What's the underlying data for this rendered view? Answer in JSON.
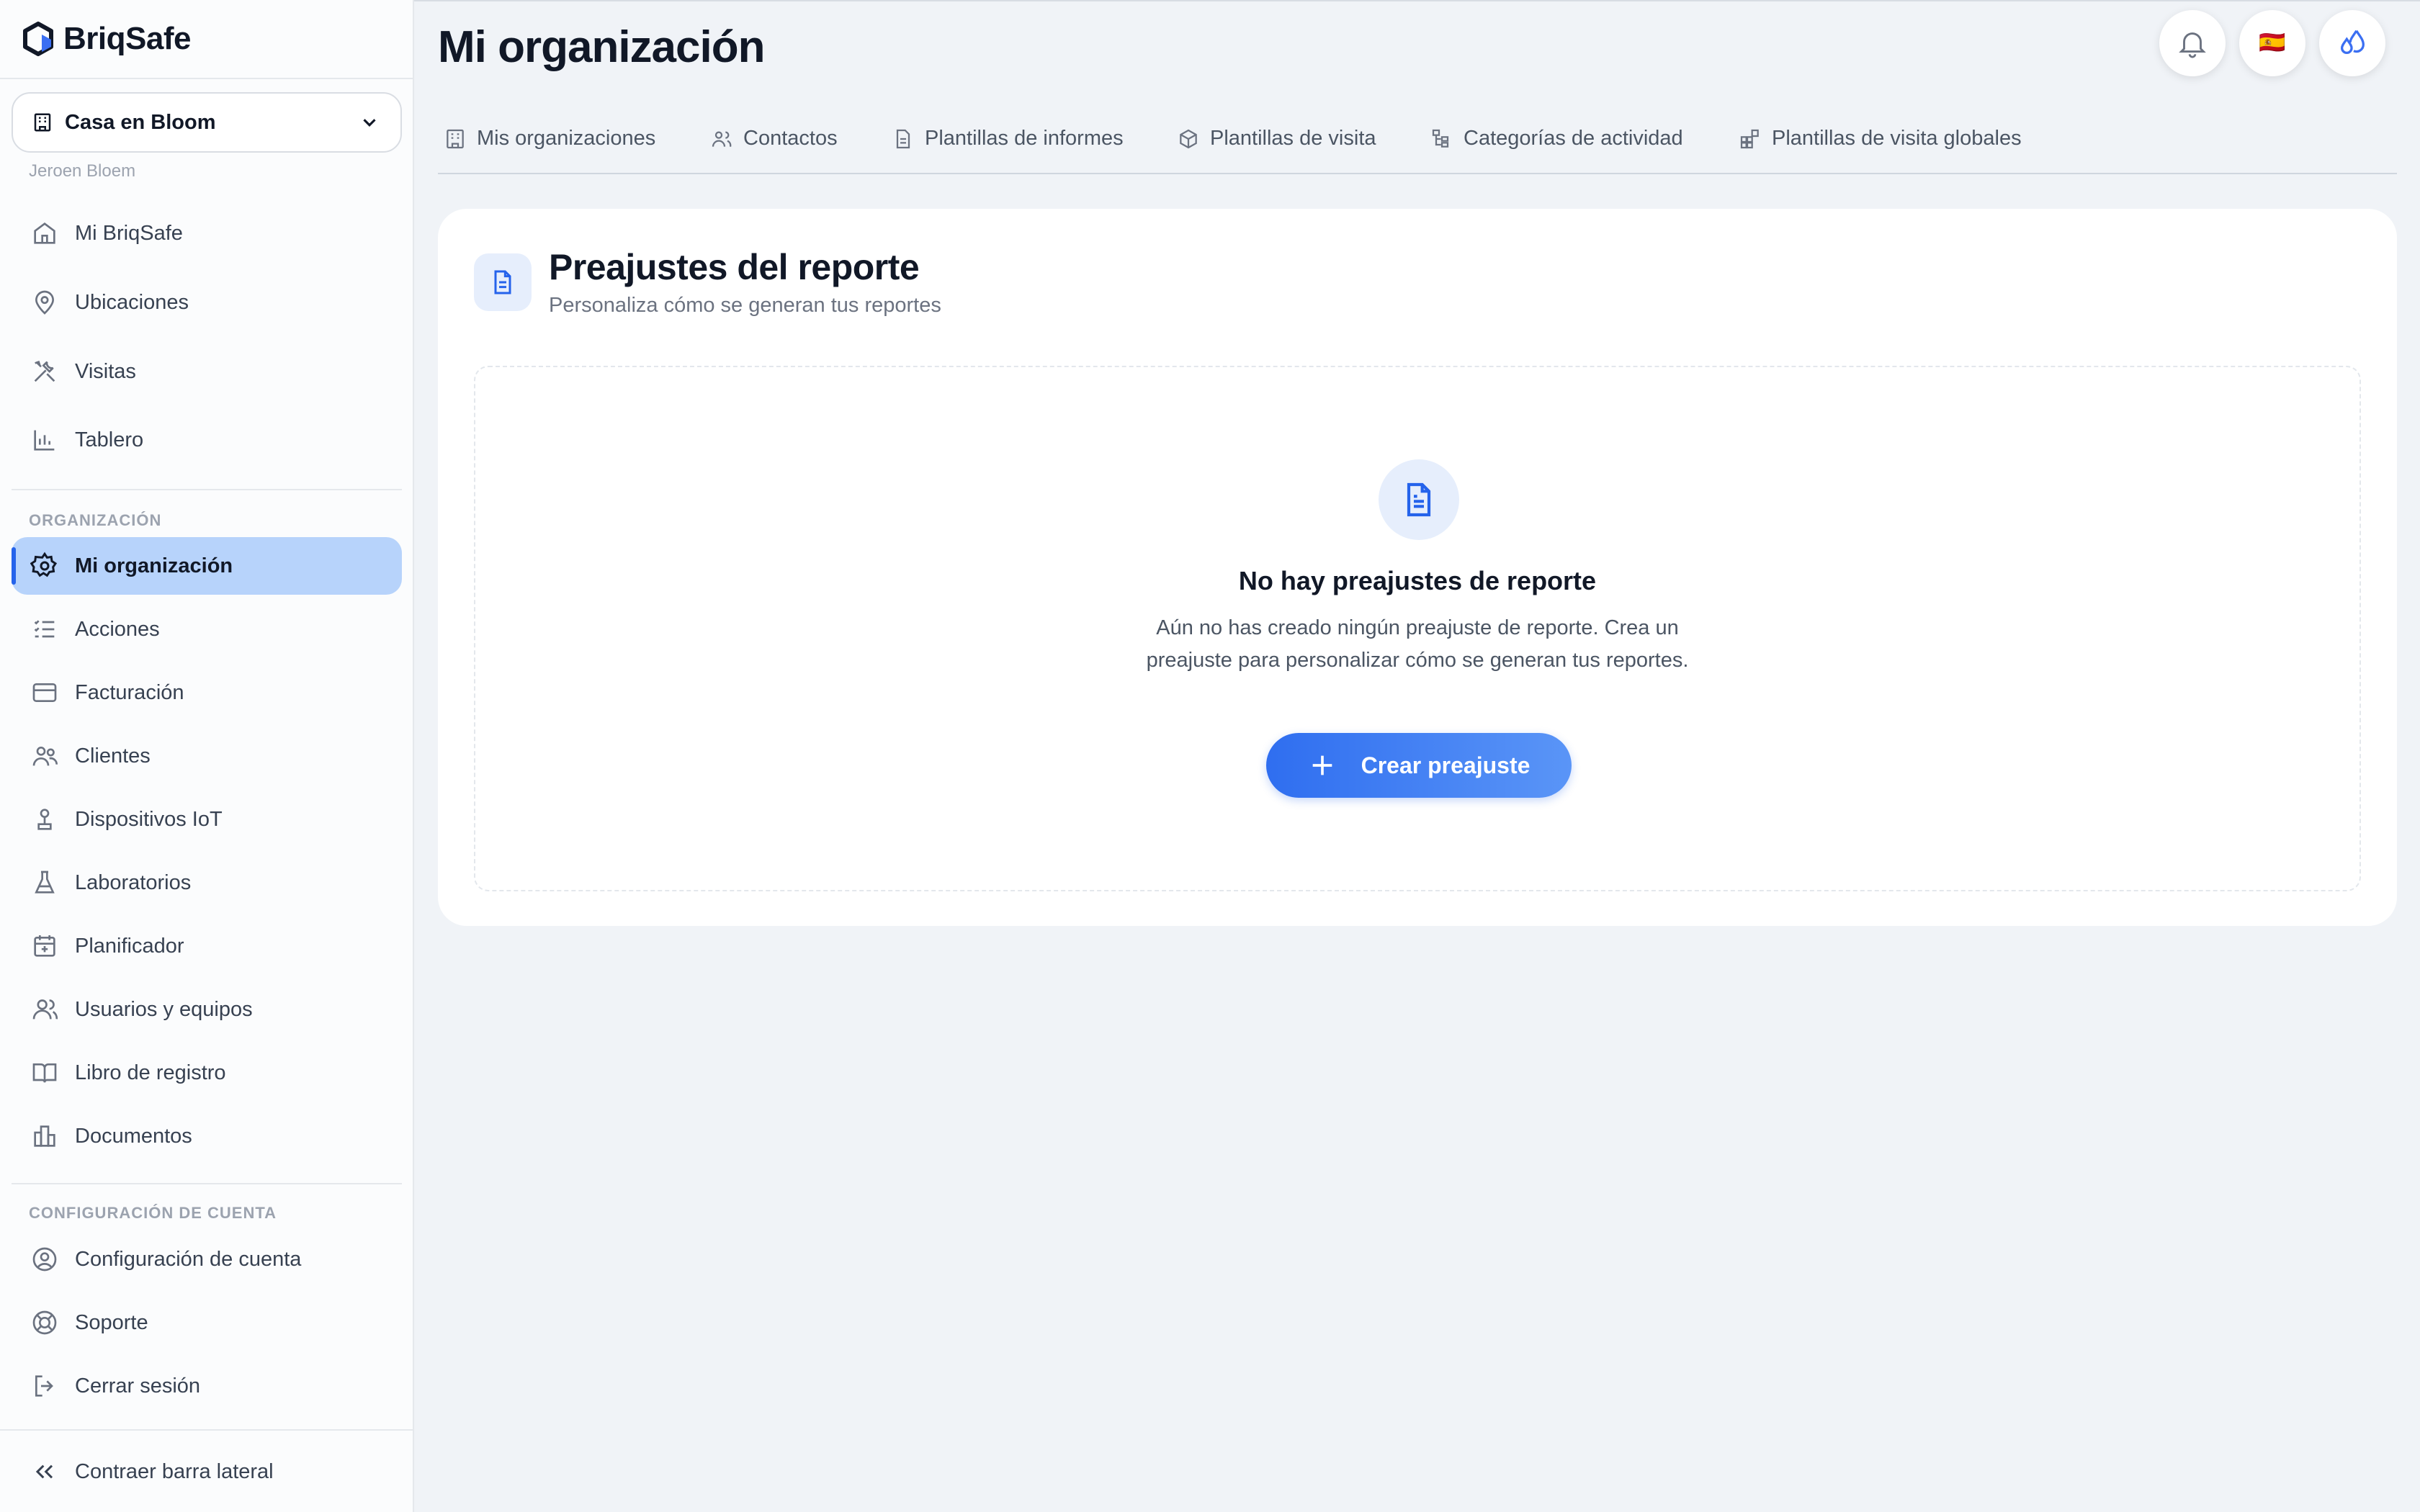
{
  "app": {
    "brand": "BriqSafe",
    "organization": "Casa en Bloom",
    "user": "Jeroen Bloem"
  },
  "sidebar": {
    "main_items": [
      {
        "label": "Mi BriqSafe",
        "icon": "home-icon"
      },
      {
        "label": "Ubicaciones",
        "icon": "map-pin-icon"
      },
      {
        "label": "Visitas",
        "icon": "tools-icon"
      },
      {
        "label": "Tablero",
        "icon": "bar-chart-icon"
      }
    ],
    "section_org": "ORGANIZACIÓN",
    "org_items": [
      {
        "label": "Mi organización",
        "icon": "gear-icon",
        "active": true
      },
      {
        "label": "Acciones",
        "icon": "list-checks-icon"
      },
      {
        "label": "Facturación",
        "icon": "credit-card-icon"
      },
      {
        "label": "Clientes",
        "icon": "users-icon"
      },
      {
        "label": "Dispositivos IoT",
        "icon": "sensor-icon"
      },
      {
        "label": "Laboratorios",
        "icon": "flask-icon"
      },
      {
        "label": "Planificador",
        "icon": "calendar-icon"
      },
      {
        "label": "Usuarios y equipos",
        "icon": "user-group-icon"
      },
      {
        "label": "Libro de registro",
        "icon": "book-icon"
      },
      {
        "label": "Documentos",
        "icon": "documents-icon"
      }
    ],
    "section_account": "CONFIGURACIÓN DE CUENTA",
    "account_items": [
      {
        "label": "Configuración de cuenta",
        "icon": "user-circle-icon"
      },
      {
        "label": "Soporte",
        "icon": "lifebuoy-icon"
      },
      {
        "label": "Cerrar sesión",
        "icon": "logout-icon"
      }
    ],
    "collapse_label": "Contraer barra lateral"
  },
  "header": {
    "title": "Mi organización",
    "actions": [
      "bell-icon",
      "flag-es-icon",
      "water-drops-icon"
    ],
    "flag": "🇪🇸"
  },
  "tabs": [
    {
      "label": "Mis organizaciones",
      "icon": "building-icon"
    },
    {
      "label": "Contactos",
      "icon": "users-icon"
    },
    {
      "label": "Plantillas de informes",
      "icon": "file-icon"
    },
    {
      "label": "Plantillas de visita",
      "icon": "box-icon"
    },
    {
      "label": "Categorías de actividad",
      "icon": "tree-icon"
    },
    {
      "label": "Plantillas de visita globales",
      "icon": "grid-plus-icon"
    }
  ],
  "card": {
    "title": "Preajustes del reporte",
    "subtitle": "Personaliza cómo se generan tus reportes",
    "empty_title": "No hay preajustes de reporte",
    "empty_description": "Aún no has creado ningún preajuste de reporte. Crea un preajuste para personalizar cómo se generan tus reportes.",
    "create_button": "Crear preajuste"
  },
  "colors": {
    "accent": "#2563eb",
    "active_bg": "#b7d3fb",
    "page_bg": "#f0f3f7"
  }
}
